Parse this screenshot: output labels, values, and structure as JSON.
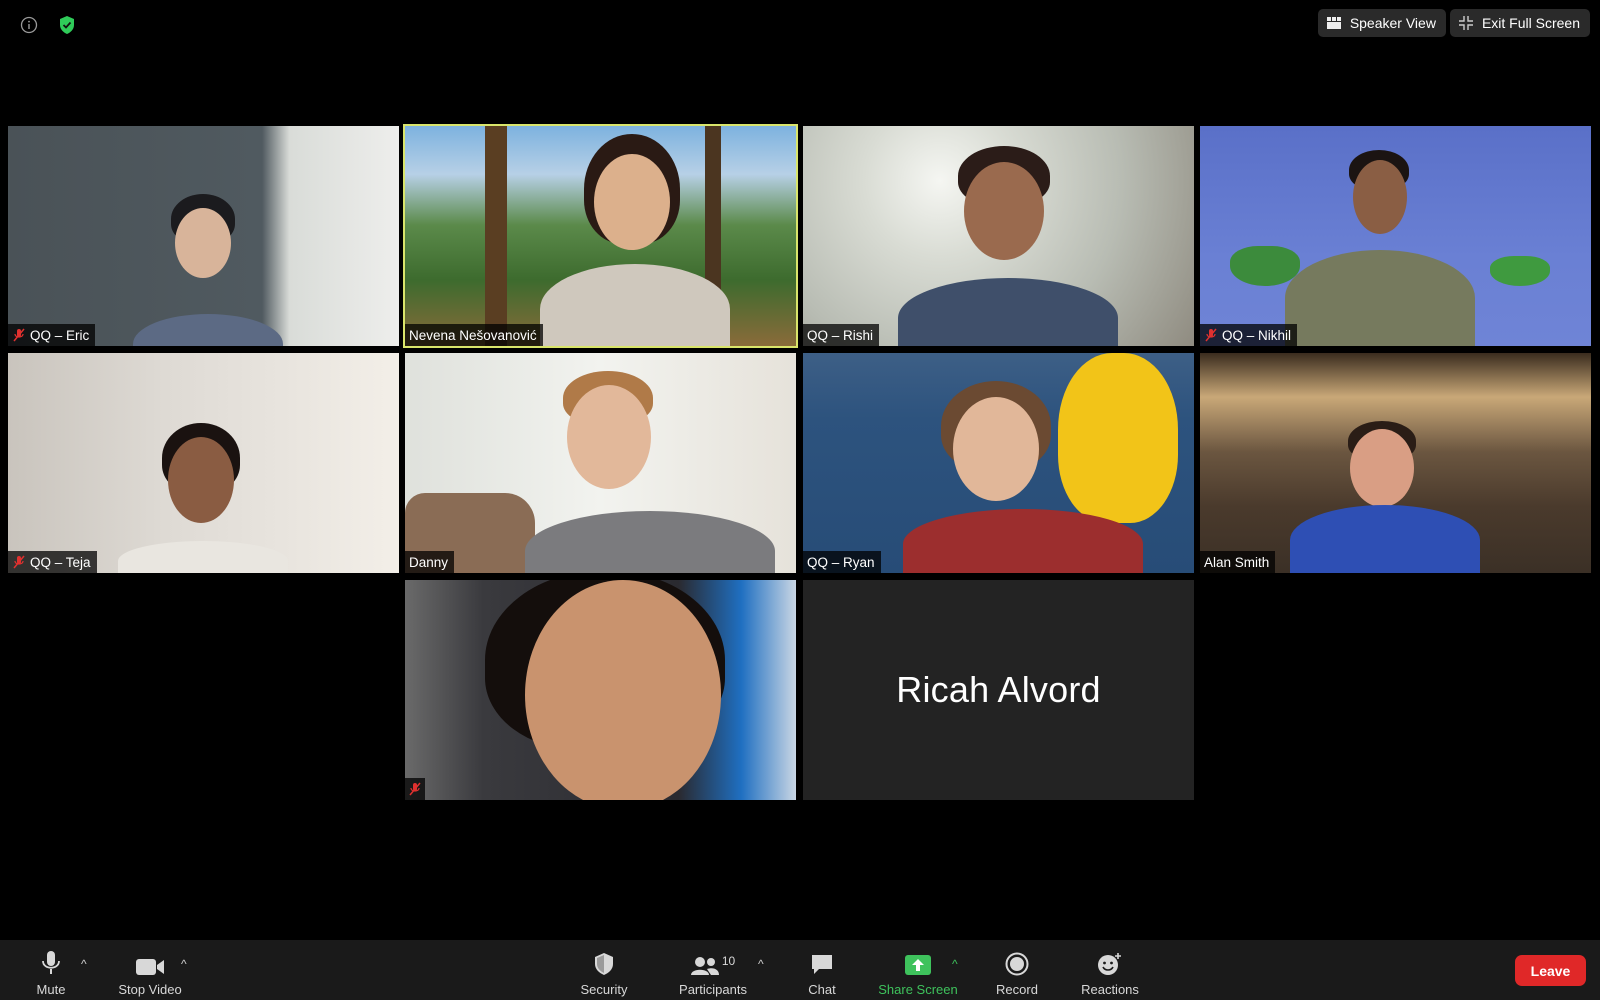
{
  "top": {
    "speaker_view": "Speaker View",
    "exit_full_screen": "Exit Full Screen"
  },
  "tiles": [
    {
      "name": "QQ – Eric",
      "muted": true
    },
    {
      "name": "Nevena Nešovanović",
      "muted": false,
      "active": true
    },
    {
      "name": "QQ – Rishi",
      "muted": false
    },
    {
      "name": "QQ – Nikhil",
      "muted": true
    },
    {
      "name": "QQ – Teja",
      "muted": true
    },
    {
      "name": "Danny",
      "muted": false
    },
    {
      "name": "QQ – Ryan",
      "muted": false
    },
    {
      "name": "Alan Smith",
      "muted": false
    },
    {
      "name": "",
      "muted": true
    },
    {
      "name": "Ricah Alvord",
      "muted": false,
      "video_off": true
    }
  ],
  "toolbar": {
    "mute": "Mute",
    "stop_video": "Stop Video",
    "security": "Security",
    "participants": "Participants",
    "participant_count": "10",
    "chat": "Chat",
    "share_screen": "Share Screen",
    "record": "Record",
    "reactions": "Reactions",
    "leave": "Leave"
  },
  "colors": {
    "active_speaker_border": "#d9e56b",
    "share_green": "#3ec25c",
    "leave_red": "#e02828",
    "shield_green": "#2fcb59"
  }
}
